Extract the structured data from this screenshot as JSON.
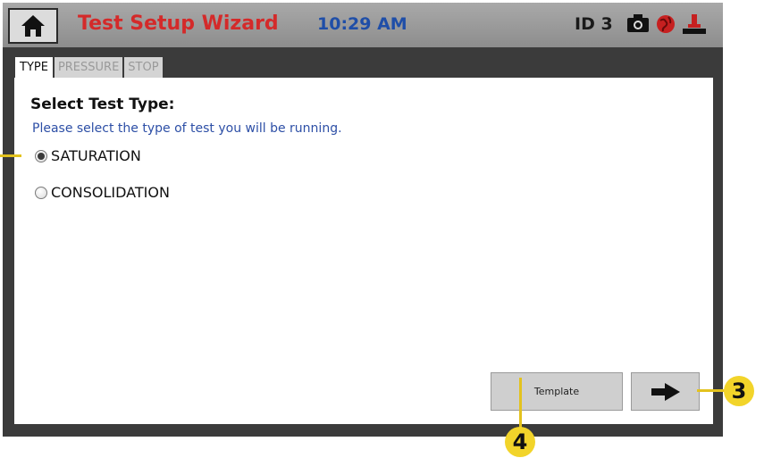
{
  "header": {
    "title": "Test Setup Wizard",
    "time": "10:29 AM",
    "device_id": "ID 3",
    "icons": [
      "home-icon",
      "camera-icon",
      "globe-icon",
      "valve-icon"
    ]
  },
  "tabs": [
    {
      "label": "TYPE",
      "active": true
    },
    {
      "label": "PRESSURE",
      "active": false
    },
    {
      "label": "STOP",
      "active": false
    }
  ],
  "content": {
    "heading": "Select Test Type:",
    "instruction": "Please select the type of test you will be running.",
    "options": [
      {
        "label": "SATURATION",
        "selected": true
      },
      {
        "label": "CONSOLIDATION",
        "selected": false
      }
    ]
  },
  "buttons": {
    "template_label": "Template",
    "next_icon": "arrow-right-icon"
  },
  "callouts": [
    "3",
    "4"
  ],
  "colors": {
    "title": "#d42a2a",
    "time": "#1f4ea8",
    "instruction": "#2d4fa6",
    "callout": "#f2d42a",
    "frame": "#3b3b3b"
  }
}
